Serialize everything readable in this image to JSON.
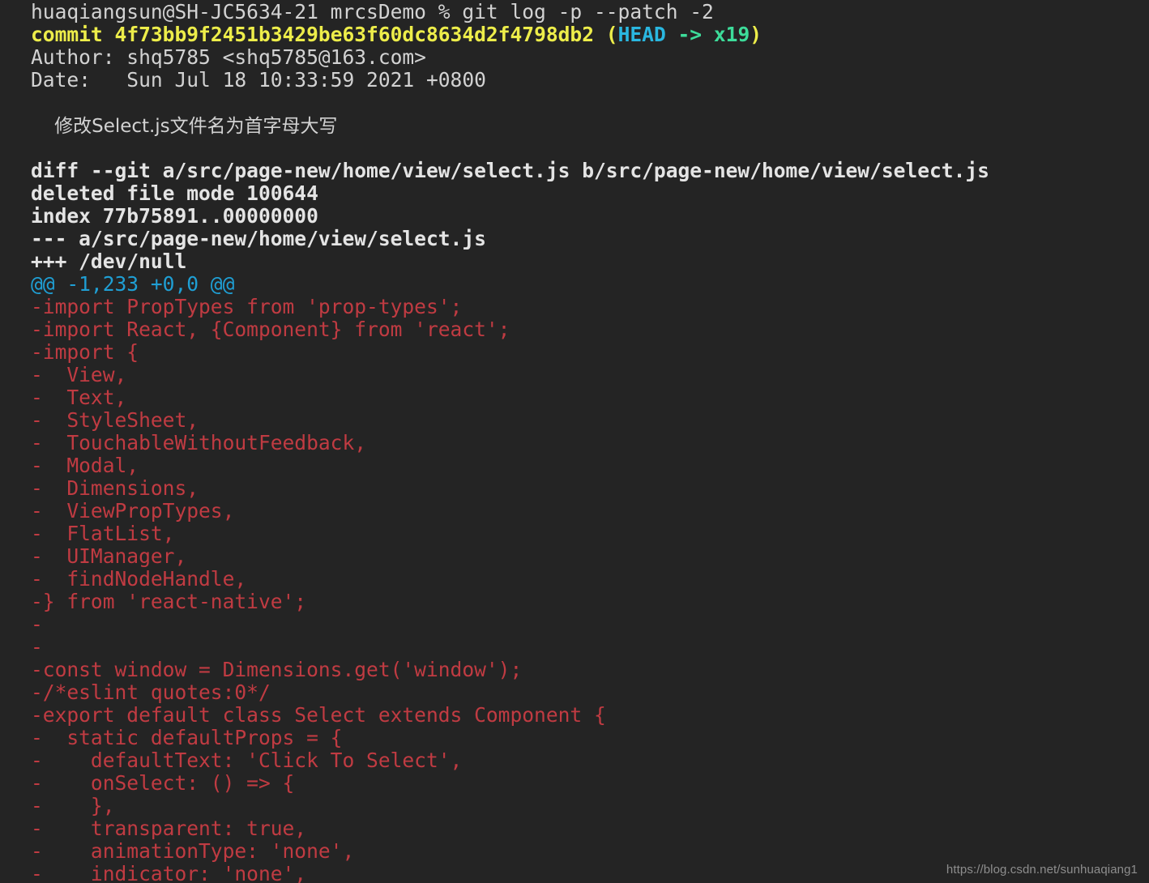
{
  "terminal": {
    "background_color": "#242424",
    "default_text_color": "#d2d2d2",
    "colors": {
      "commit_yellow": "#eded4a",
      "head_cyan": "#2ab7e0",
      "branch_green": "#3ddc9a",
      "meta_white": "#e4e4e4",
      "hunk_cyan": "#1f9fd4",
      "removed_red": "#c03b42",
      "watermark_grey": "#8d8d8d"
    },
    "prompt": {
      "user": "huaqiangsun",
      "host": "SH-JC5634-21",
      "cwd": "mrcsDemo",
      "symbol": "%",
      "command": "git log -p --patch -2",
      "full_line": "huaqiangsun@SH-JC5634-21 mrcsDemo % git log -p --patch -2"
    },
    "commit": {
      "keyword": "commit",
      "hash": "4f73bb9f2451b3429be63f60dc8634d2f4798db2",
      "ref_open": " (",
      "head_label": "HEAD",
      "arrow_branch": " -> x19",
      "ref_close": ")",
      "author_label": "Author:",
      "author_value": " shq5785 <shq5785@163.com>",
      "date_label": "Date:",
      "date_value": "   Sun Jul 18 10:33:59 2021 +0800",
      "message": "    修改Select.js文件名为首字母大写"
    },
    "diff_meta": [
      "diff --git a/src/page-new/home/view/select.js b/src/page-new/home/view/select.js",
      "deleted file mode 100644",
      "index 77b75891..00000000",
      "--- a/src/page-new/home/view/select.js",
      "+++ /dev/null"
    ],
    "hunk_header": "@@ -1,233 +0,0 @@",
    "removed_lines": [
      "-import PropTypes from 'prop-types';",
      "-import React, {Component} from 'react';",
      "-import {",
      "-  View,",
      "-  Text,",
      "-  StyleSheet,",
      "-  TouchableWithoutFeedback,",
      "-  Modal,",
      "-  Dimensions,",
      "-  ViewPropTypes,",
      "-  FlatList,",
      "-  UIManager,",
      "-  findNodeHandle,",
      "-} from 'react-native';",
      "-",
      "-",
      "-const window = Dimensions.get('window');",
      "-/*eslint quotes:0*/",
      "-export default class Select extends Component {",
      "-  static defaultProps = {",
      "-    defaultText: 'Click To Select',",
      "-    onSelect: () => {",
      "-    },",
      "-    transparent: true,",
      "-    animationType: 'none',",
      "-    indicator: 'none',"
    ],
    "watermark": "https://blog.csdn.net/sunhuaqiang1"
  }
}
